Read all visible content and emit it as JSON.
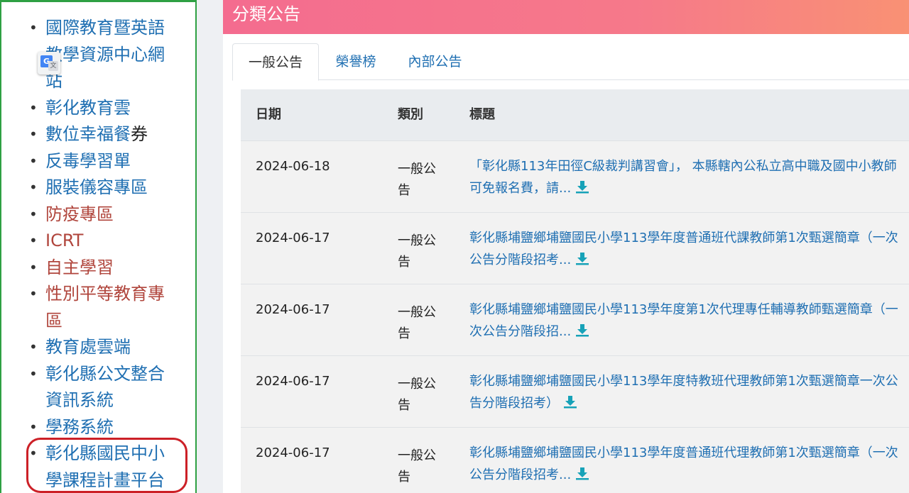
{
  "sidebar": {
    "items": [
      {
        "label": "國際教育暨英語教學資源中心網站",
        "color": "blue"
      },
      {
        "label": "彰化教育雲",
        "color": "blue"
      },
      {
        "label_a": "數位幸福餐",
        "label_b": "券",
        "color": "mixed"
      },
      {
        "label": "反毒學習單",
        "color": "blue"
      },
      {
        "label": "服裝儀容專區",
        "color": "blue"
      },
      {
        "label": "防疫專區",
        "color": "red"
      },
      {
        "label": "ICRT",
        "color": "red"
      },
      {
        "label": "自主學習",
        "color": "red"
      },
      {
        "label": "性別平等教育專區",
        "color": "red"
      },
      {
        "label": "教育處雲端",
        "color": "blue"
      },
      {
        "label": "彰化縣公文整合資訊系統",
        "color": "blue"
      },
      {
        "label": "學務系統",
        "color": "blue"
      },
      {
        "label": "彰化縣國民中小學課程計畫平台",
        "color": "blue"
      }
    ]
  },
  "panel": {
    "header": "分類公告",
    "tabs": [
      "一般公告",
      "榮譽榜",
      "內部公告"
    ],
    "active_tab": "一般公告"
  },
  "table": {
    "headers": {
      "date": "日期",
      "category": "類別",
      "title": "標題"
    },
    "rows": [
      {
        "date": "2024-06-18",
        "category": "一般公告",
        "title": "「彰化縣113年田徑C級裁判講習會」， 本縣轄內公私立高中職及國中小教師可免報名費，請..."
      },
      {
        "date": "2024-06-17",
        "category": "一般公告",
        "title": "彰化縣埔鹽鄉埔鹽國民小學113學年度普通班代課教師第1次甄選簡章（一次公告分階段招考..."
      },
      {
        "date": "2024-06-17",
        "category": "一般公告",
        "title": "彰化縣埔鹽鄉埔鹽國民小學113學年度第1次代理專任輔導教師甄選簡章（一次公告分階段招..."
      },
      {
        "date": "2024-06-17",
        "category": "一般公告",
        "title": "彰化縣埔鹽鄉埔鹽國民小學113學年度特教班代理教師第1次甄選簡章一次公告分階段招考）"
      },
      {
        "date": "2024-06-17",
        "category": "一般公告",
        "title": "彰化縣埔鹽鄉埔鹽國民小學113學年度普通班代理教師第1次甄選簡章（一次公告分階段招考..."
      }
    ]
  },
  "colors": {
    "accent_green": "#2ea043",
    "link_blue": "#1f6fb2",
    "link_red": "#b0453c",
    "highlight_red": "#cc2027",
    "icon_teal": "#17a2b8"
  },
  "icons": {
    "translate": "google-translate-icon",
    "download": "download-icon"
  }
}
